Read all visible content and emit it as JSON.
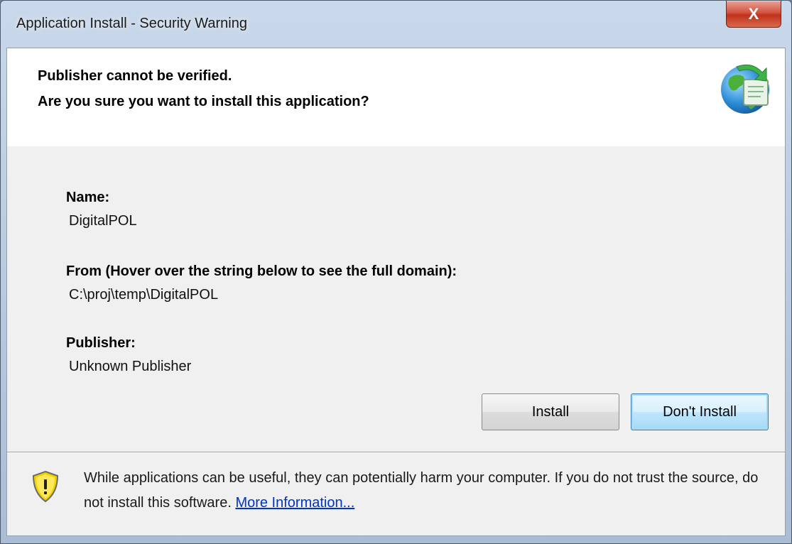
{
  "window": {
    "title": "Application Install - Security Warning",
    "close_glyph": "X"
  },
  "header": {
    "line1": "Publisher cannot be verified.",
    "line2": "Are you sure you want to install this application?",
    "icon": "globe-install-icon"
  },
  "details": {
    "name_label": "Name:",
    "name_value": "DigitalPOL",
    "from_label": "From (Hover over the string below to see the full domain):",
    "from_value": "C:\\proj\\temp\\DigitalPOL",
    "publisher_label": "Publisher:",
    "publisher_value": "Unknown Publisher"
  },
  "buttons": {
    "install": "Install",
    "dont_install": "Don't Install"
  },
  "footer": {
    "icon": "shield-warning-icon",
    "text": "While applications can be useful, they can potentially harm your computer. If you do not trust the source, do not install this software. ",
    "link": "More Information..."
  },
  "colors": {
    "link": "#0033cc",
    "close_button": "#c1301b",
    "shield": "#f2d200"
  }
}
